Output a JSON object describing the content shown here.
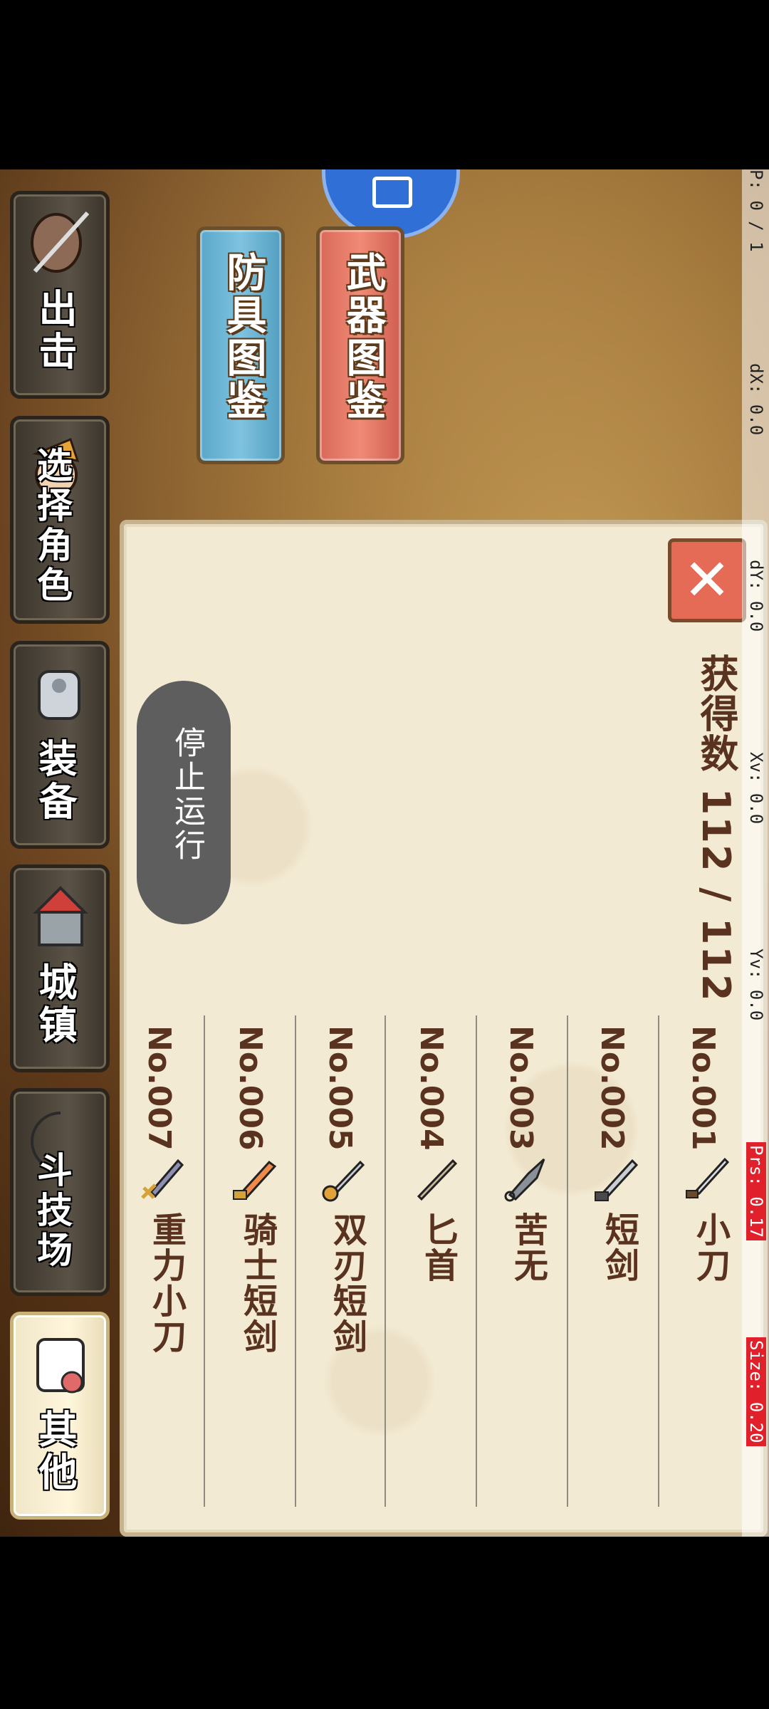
{
  "debug": {
    "p": "P: 0 / 1",
    "dx": "dX: 0.0",
    "dy": "dY: 0.0",
    "xv": "Xv: 0.0",
    "yv": "Yv: 0.0",
    "prs": "Prs: 0.17",
    "size": "Size: 0.20"
  },
  "tabs": {
    "weapons": "武器图鉴",
    "armor": "防具图鉴"
  },
  "menu": [
    {
      "label": "出击",
      "icon": "helmet-sword-icon"
    },
    {
      "label": "选择角色",
      "icon": "character-icon"
    },
    {
      "label": "装备",
      "icon": "armor-icon"
    },
    {
      "label": "城镇",
      "icon": "town-icon"
    },
    {
      "label": "斗技场",
      "icon": "arena-icon"
    },
    {
      "label": "其他",
      "icon": "scroll-icon",
      "active": true
    }
  ],
  "panel": {
    "close": "✕",
    "count": "获得数 112 / 112"
  },
  "toast": "停止运行",
  "weapons": [
    {
      "no": "No.001",
      "name": "小刀",
      "icon": "knife-icon"
    },
    {
      "no": "No.002",
      "name": "短剑",
      "icon": "short-sword-icon"
    },
    {
      "no": "No.003",
      "name": "苦无",
      "icon": "kunai-icon"
    },
    {
      "no": "No.004",
      "name": "匕首",
      "icon": "dagger-icon"
    },
    {
      "no": "No.005",
      "name": "双刃短剑",
      "icon": "twin-blade-icon"
    },
    {
      "no": "No.006",
      "name": "骑士短剑",
      "icon": "knight-sword-icon"
    },
    {
      "no": "No.007",
      "name": "重力小刀",
      "icon": "gravity-knife-icon"
    }
  ]
}
